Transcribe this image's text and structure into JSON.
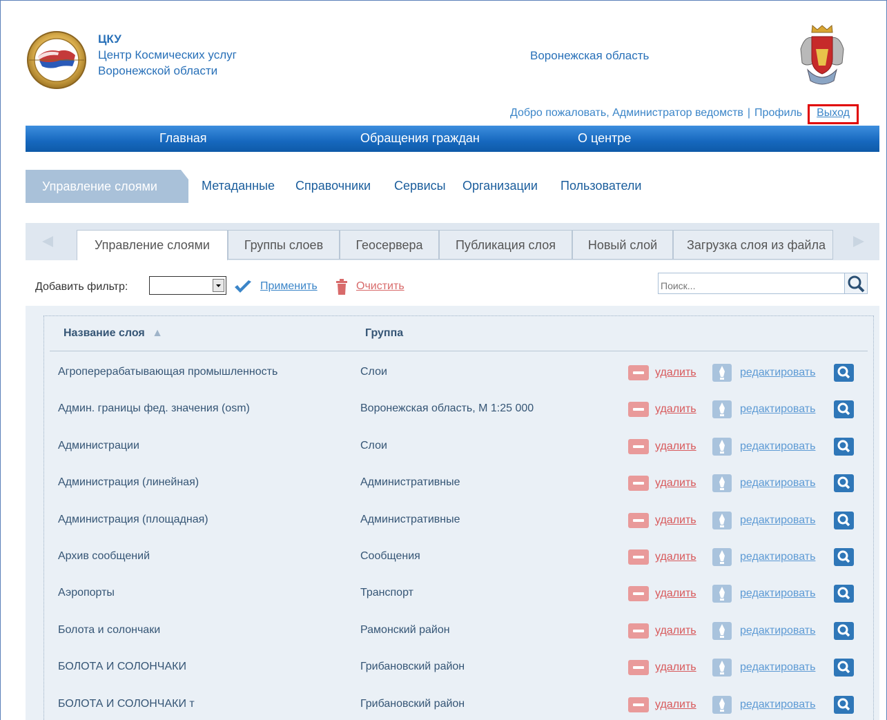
{
  "header": {
    "brand_title": "ЦКУ",
    "brand_line1": "Центр Космических услуг",
    "brand_line2": "Воронежской области",
    "region": "Воронежская область",
    "welcome": "Добро пожаловать, Администратор ведомств",
    "separator": "|",
    "profile": "Профиль",
    "logout": "Выход"
  },
  "main_nav": [
    "Главная",
    "Обращения граждан",
    "О центре"
  ],
  "sub_nav": {
    "active": "Управление слоями",
    "items": [
      "Метаданные",
      "Справочники",
      "Сервисы",
      "Организации",
      "Пользователи"
    ]
  },
  "tabs": [
    "Управление слоями",
    "Группы слоев",
    "Геосервера",
    "Публикация слоя",
    "Новый слой",
    "Загрузка слоя из файла"
  ],
  "active_tab": "Управление слоями",
  "filter": {
    "label": "Добавить фильтр:",
    "selected": "",
    "apply": "Применить",
    "clear": "Очистить",
    "search_placeholder": "Поиск..."
  },
  "table": {
    "columns": [
      "Название слоя",
      "Группа"
    ],
    "sort_indicator": "▲",
    "delete_label": "удалить",
    "edit_label": "редактировать",
    "rows": [
      {
        "name": "Агроперерабатывающая промышленность",
        "group": "Слои"
      },
      {
        "name": "Админ. границы фед. значения (osm)",
        "group": "Воронежская область, М 1:25 000"
      },
      {
        "name": "Администрации",
        "group": "Слои"
      },
      {
        "name": "Администрация (линейная)",
        "group": "Административные"
      },
      {
        "name": "Администрация (площадная)",
        "group": "Административные"
      },
      {
        "name": "Архив сообщений",
        "group": "Сообщения"
      },
      {
        "name": "Аэропорты",
        "group": "Транспорт"
      },
      {
        "name": "Болота и солончаки",
        "group": "Рамонский район"
      },
      {
        "name": "БОЛОТА И СОЛОНЧАКИ",
        "group": "Грибановский район"
      },
      {
        "name": "БОЛОТА И СОЛОНЧАКИ т",
        "group": "Грибановский район"
      }
    ]
  },
  "colors": {
    "nav_blue": "#1668be",
    "link_blue": "#3b85c8",
    "delete_red": "#d8595b",
    "highlight_red": "#e00000"
  }
}
